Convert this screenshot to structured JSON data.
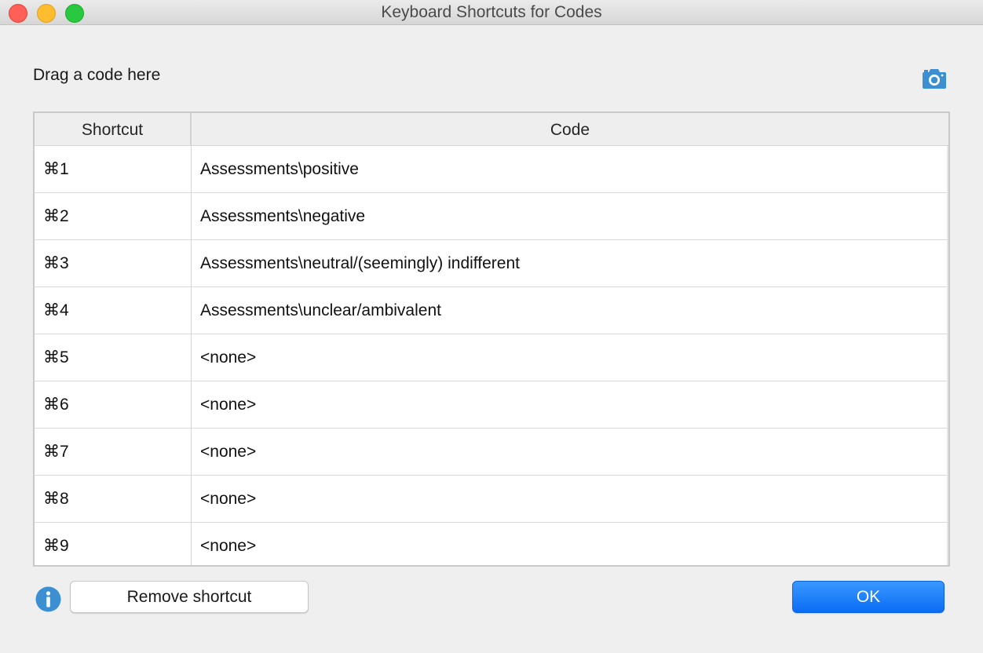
{
  "window": {
    "title": "Keyboard Shortcuts for Codes"
  },
  "drag_label": "Drag a code here",
  "icons": {
    "camera": "camera-icon",
    "info": "info-icon"
  },
  "table": {
    "headers": {
      "shortcut": "Shortcut",
      "code": "Code"
    },
    "rows": [
      {
        "shortcut": "⌘1",
        "code": "Assessments\\positive"
      },
      {
        "shortcut": "⌘2",
        "code": "Assessments\\negative"
      },
      {
        "shortcut": "⌘3",
        "code": "Assessments\\neutral/(seemingly) indifferent"
      },
      {
        "shortcut": "⌘4",
        "code": "Assessments\\unclear/ambivalent"
      },
      {
        "shortcut": "⌘5",
        "code": "<none>"
      },
      {
        "shortcut": "⌘6",
        "code": "<none>"
      },
      {
        "shortcut": "⌘7",
        "code": "<none>"
      },
      {
        "shortcut": "⌘8",
        "code": "<none>"
      },
      {
        "shortcut": "⌘9",
        "code": "<none>"
      }
    ]
  },
  "buttons": {
    "remove_shortcut": "Remove shortcut",
    "ok": "OK"
  },
  "colors": {
    "accent": "#0a6cf5",
    "icon_blue": "#3c8fd1"
  }
}
